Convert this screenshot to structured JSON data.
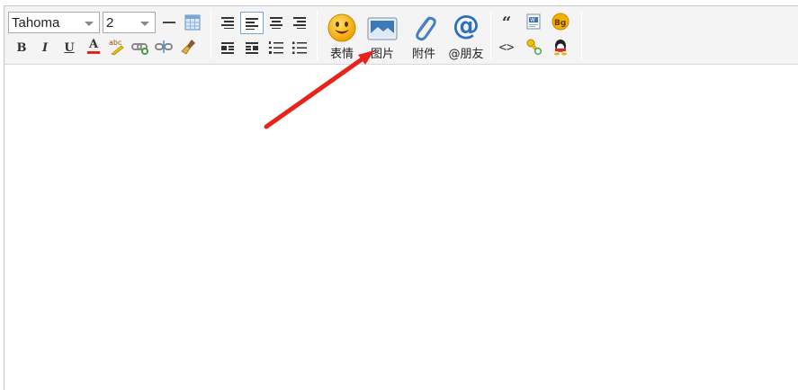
{
  "toolbar": {
    "font_family": {
      "value": "Tahoma"
    },
    "font_size": {
      "value": "2"
    },
    "buttons": {
      "bold": "B",
      "italic": "I",
      "underline": "U",
      "font_color": "A",
      "spellcheck_label": "abc"
    },
    "insert": {
      "emoji_label": "表情",
      "image_label": "图片",
      "attachment_label": "附件",
      "mention_label": "@朋友"
    },
    "misc": {
      "quote": "“",
      "code": "<>",
      "bg_label": "Bg"
    }
  },
  "colors": {
    "annotation_arrow": "#e8231b",
    "toolbar_bg": "#f4f4f4",
    "accent_blue": "#2b6fbf"
  }
}
